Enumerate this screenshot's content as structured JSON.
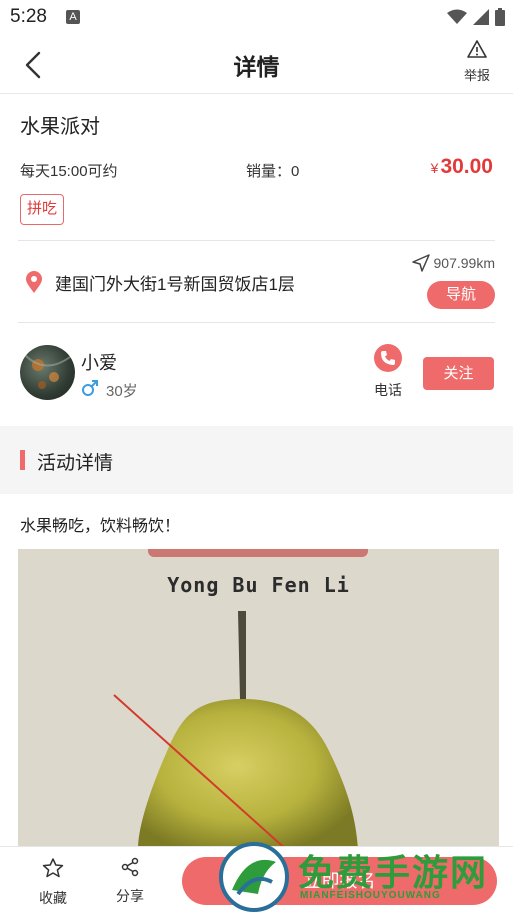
{
  "status_bar": {
    "time": "5:28",
    "notif_icon": "A"
  },
  "header": {
    "title": "详情",
    "report_label": "举报"
  },
  "event": {
    "title": "水果派对",
    "schedule": "每天15:00可约",
    "sales": "销量：0",
    "price_symbol": "¥",
    "price": "30.00",
    "tag": "拼吃"
  },
  "location": {
    "address": "建国门外大街1号新国贸饭店1层",
    "distance": "907.99km",
    "nav_label": "导航"
  },
  "host": {
    "name": "小爱",
    "age": "30岁",
    "phone_label": "电话",
    "follow_label": "关注"
  },
  "section": {
    "title": "活动详情"
  },
  "description": "水果畅吃，饮料畅饮！",
  "photo": {
    "caption": "Yong Bu Fen Li"
  },
  "bottom_bar": {
    "collect_label": "收藏",
    "share_label": "分享",
    "signup_label": "立即报名"
  },
  "watermark": {
    "text": "免费手游网",
    "sub": "MIANFEISHOUYOUWANG"
  },
  "colors": {
    "accent": "#ef6b6b",
    "price": "#e23a3a",
    "watermark": "#2e9c3a"
  }
}
